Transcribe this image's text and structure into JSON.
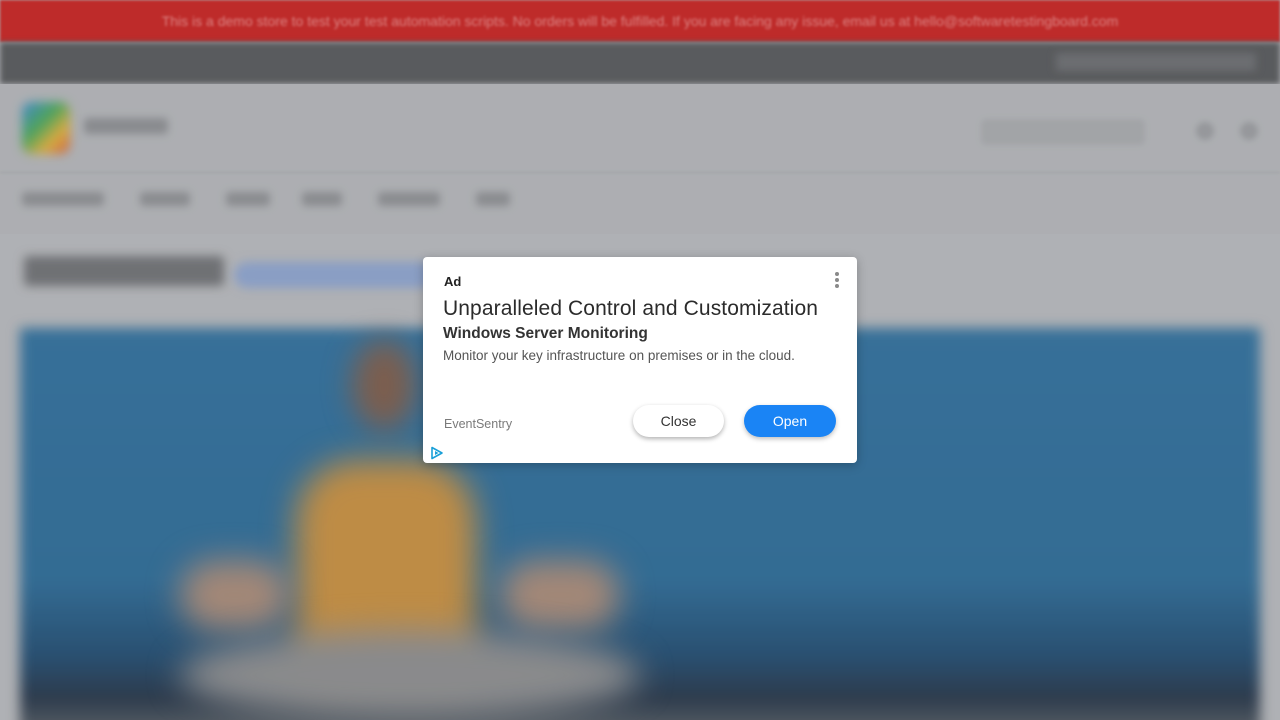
{
  "background": {
    "announcement": "This is a demo store to test your test automation scripts. No orders will be fulfilled. If you are facing any issue, email us at hello@softwaretestingboard.com"
  },
  "ad": {
    "label": "Ad",
    "headline": "Unparalleled Control and Customization",
    "subheadline": "Windows Server Monitoring",
    "body": "Monitor your key infrastructure on premises or in the cloud.",
    "advertiser": "EventSentry",
    "close_label": "Close",
    "open_label": "Open",
    "menu_icon": "more-vertical-icon",
    "adchoices_icon": "adchoices-icon"
  },
  "colors": {
    "announcement_bar": "#c8201f",
    "open_button": "#1a84f5",
    "adchoices": "#1aa0d8"
  }
}
